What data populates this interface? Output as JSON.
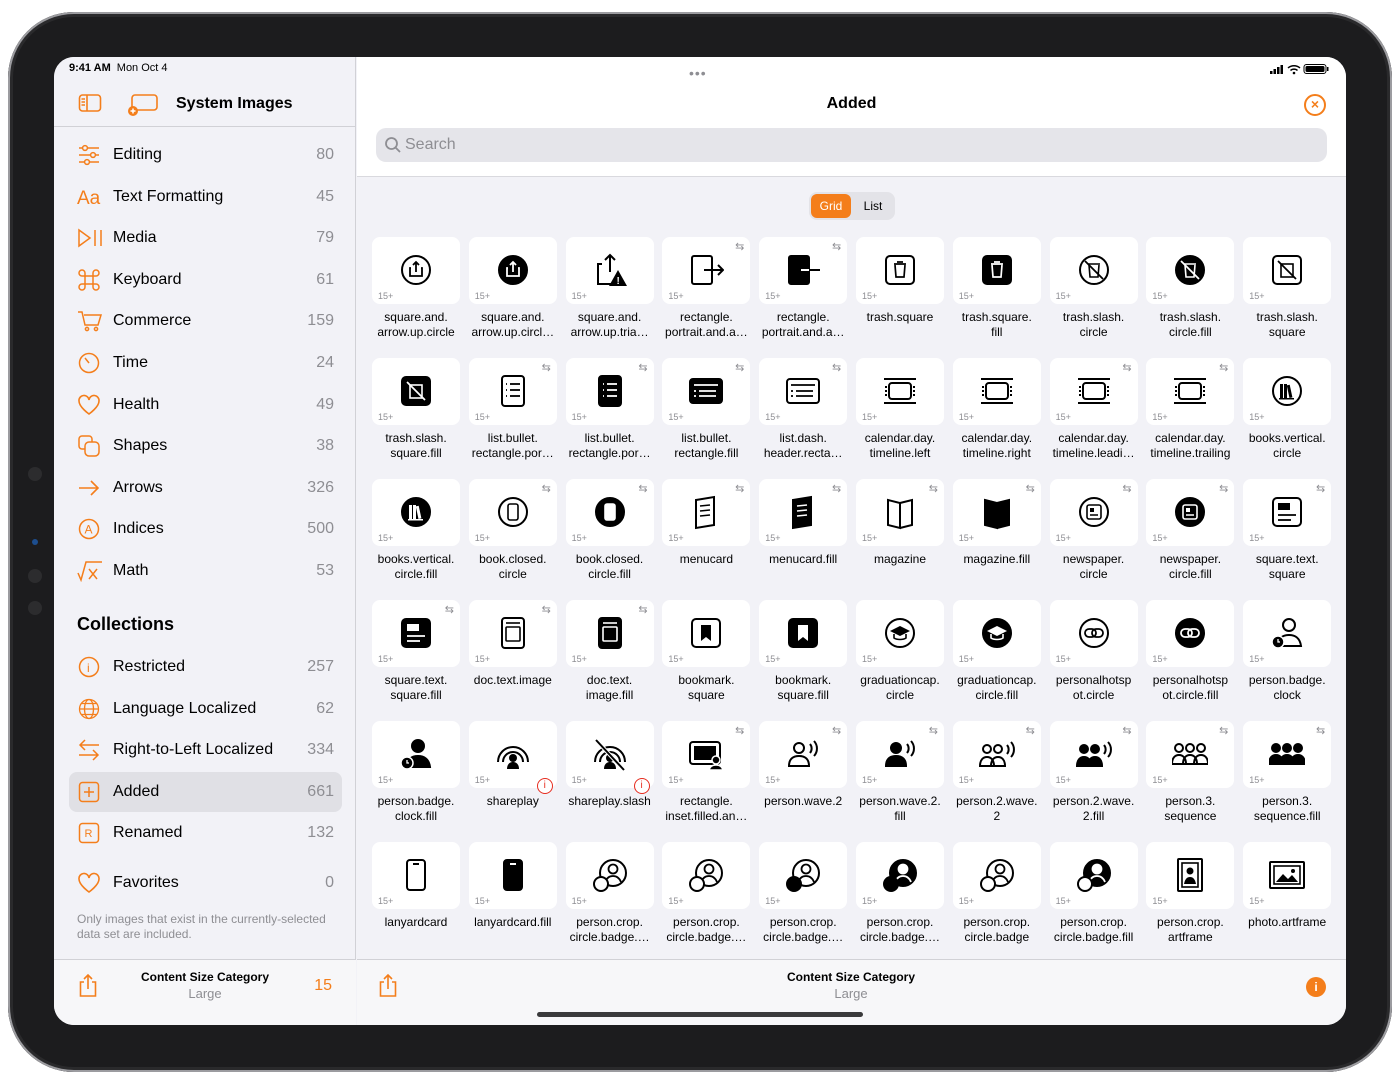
{
  "status": {
    "time": "9:41 AM",
    "date": "Mon Oct 4"
  },
  "sidebar": {
    "title": "System Images",
    "categories": [
      {
        "icon": "sliders-icon",
        "label": "Editing",
        "count": "80"
      },
      {
        "icon": "text-format-icon",
        "label": "Text Formatting",
        "count": "45"
      },
      {
        "icon": "play-pause-icon",
        "label": "Media",
        "count": "79"
      },
      {
        "icon": "command-key-icon",
        "label": "Keyboard",
        "count": "61"
      },
      {
        "icon": "cart-icon",
        "label": "Commerce",
        "count": "159"
      },
      {
        "icon": "timer-icon",
        "label": "Time",
        "count": "24"
      },
      {
        "icon": "heart-icon",
        "label": "Health",
        "count": "49"
      },
      {
        "icon": "shapes-icon",
        "label": "Shapes",
        "count": "38"
      },
      {
        "icon": "arrow-right-icon",
        "label": "Arrows",
        "count": "326"
      },
      {
        "icon": "indices-icon",
        "label": "Indices",
        "count": "500"
      },
      {
        "icon": "function-icon",
        "label": "Math",
        "count": "53"
      }
    ],
    "collections_header": "Collections",
    "collections": [
      {
        "icon": "info-circle-icon",
        "label": "Restricted",
        "count": "257"
      },
      {
        "icon": "globe-icon",
        "label": "Language Localized",
        "count": "62"
      },
      {
        "icon": "rtl-arrows-icon",
        "label": "Right-to-Left Localized",
        "count": "334"
      },
      {
        "icon": "plus-square-icon",
        "label": "Added",
        "count": "661",
        "selected": true
      },
      {
        "icon": "renamed-icon",
        "label": "Renamed",
        "count": "132"
      }
    ],
    "favorites": {
      "icon": "heart-icon",
      "label": "Favorites",
      "count": "0"
    },
    "footnote": "Only images that exist in the currently-selected data set are included.",
    "bottom": {
      "title": "Content Size Category",
      "subtitle": "Large",
      "value": "15"
    }
  },
  "main": {
    "title": "Added",
    "search_placeholder": "Search",
    "view_modes": [
      "Grid",
      "List"
    ],
    "active_view": "Grid",
    "version_tag": "15+",
    "bottom": {
      "title": "Content Size Category",
      "subtitle": "Large"
    },
    "symbols": [
      {
        "name": "square.and.\narrow.up.circle",
        "icon": "share-circle-icon"
      },
      {
        "name": "square.and.\narrow.up.circl…",
        "icon": "share-circle-fill-icon"
      },
      {
        "name": "square.and.\narrow.up.tria…",
        "icon": "share-triangle-icon"
      },
      {
        "name": "rectangle.\nportrait.and.a…",
        "icon": "portrait-arrow-icon",
        "rtl": true
      },
      {
        "name": "rectangle.\nportrait.and.a…",
        "icon": "portrait-arrow-fill-icon",
        "rtl": true
      },
      {
        "name": "trash.square",
        "icon": "trash-square-icon"
      },
      {
        "name": "trash.square.\nfill",
        "icon": "trash-square-fill-icon"
      },
      {
        "name": "trash.slash.\ncircle",
        "icon": "trash-slash-circle-icon"
      },
      {
        "name": "trash.slash.\ncircle.fill",
        "icon": "trash-slash-circle-fill-icon"
      },
      {
        "name": "trash.slash.\nsquare",
        "icon": "trash-slash-square-icon"
      },
      {
        "name": "trash.slash.\nsquare.fill",
        "icon": "trash-slash-square-fill-icon"
      },
      {
        "name": "list.bullet.\nrectangle.por…",
        "icon": "list-portrait-icon",
        "rtl": true
      },
      {
        "name": "list.bullet.\nrectangle.por…",
        "icon": "list-portrait-fill-icon",
        "rtl": true
      },
      {
        "name": "list.bullet.\nrectangle.fill",
        "icon": "list-rect-fill-icon",
        "rtl": true
      },
      {
        "name": "list.dash.\nheader.recta…",
        "icon": "list-header-icon",
        "rtl": true
      },
      {
        "name": "calendar.day.\ntimeline.left",
        "icon": "timeline-left-icon"
      },
      {
        "name": "calendar.day.\ntimeline.right",
        "icon": "timeline-right-icon"
      },
      {
        "name": "calendar.day.\ntimeline.leadi…",
        "icon": "timeline-leading-icon",
        "rtl": true
      },
      {
        "name": "calendar.day.\ntimeline.trailing",
        "icon": "timeline-trailing-icon",
        "rtl": true
      },
      {
        "name": "books.vertical.\ncircle",
        "icon": "books-circle-icon"
      },
      {
        "name": "books.vertical.\ncircle.fill",
        "icon": "books-circle-fill-icon"
      },
      {
        "name": "book.closed.\ncircle",
        "icon": "book-circle-icon",
        "rtl": true
      },
      {
        "name": "book.closed.\ncircle.fill",
        "icon": "book-circle-fill-icon",
        "rtl": true
      },
      {
        "name": "menucard",
        "icon": "menucard-icon",
        "rtl": true
      },
      {
        "name": "menucard.fill",
        "icon": "menucard-fill-icon",
        "rtl": true
      },
      {
        "name": "magazine",
        "icon": "magazine-icon",
        "rtl": true
      },
      {
        "name": "magazine.fill",
        "icon": "magazine-fill-icon",
        "rtl": true
      },
      {
        "name": "newspaper.\ncircle",
        "icon": "newspaper-circle-icon",
        "rtl": true
      },
      {
        "name": "newspaper.\ncircle.fill",
        "icon": "newspaper-circle-fill-icon",
        "rtl": true
      },
      {
        "name": "square.text.\nsquare",
        "icon": "square-text-icon",
        "rtl": true
      },
      {
        "name": "square.text.\nsquare.fill",
        "icon": "square-text-fill-icon",
        "rtl": true
      },
      {
        "name": "doc.text.image",
        "icon": "doc-image-icon",
        "rtl": true
      },
      {
        "name": "doc.text.\nimage.fill",
        "icon": "doc-image-fill-icon",
        "rtl": true
      },
      {
        "name": "bookmark.\nsquare",
        "icon": "bookmark-square-icon"
      },
      {
        "name": "bookmark.\nsquare.fill",
        "icon": "bookmark-square-fill-icon"
      },
      {
        "name": "graduationcap.\ncircle",
        "icon": "gradcap-circle-icon"
      },
      {
        "name": "graduationcap.\ncircle.fill",
        "icon": "gradcap-circle-fill-icon"
      },
      {
        "name": "personalhotsp\not.circle",
        "icon": "hotspot-circle-icon"
      },
      {
        "name": "personalhotsp\not.circle.fill",
        "icon": "hotspot-circle-fill-icon"
      },
      {
        "name": "person.badge.\nclock",
        "icon": "person-clock-icon"
      },
      {
        "name": "person.badge.\nclock.fill",
        "icon": "person-clock-fill-icon"
      },
      {
        "name": "shareplay",
        "icon": "shareplay-icon",
        "restricted": true
      },
      {
        "name": "shareplay.slash",
        "icon": "shareplay-slash-icon",
        "restricted": true
      },
      {
        "name": "rectangle.\ninset.filled.an…",
        "icon": "rect-person-icon",
        "rtl": true
      },
      {
        "name": "person.wave.2",
        "icon": "person-wave-icon",
        "rtl": true
      },
      {
        "name": "person.wave.2.\nfill",
        "icon": "person-wave-fill-icon",
        "rtl": true
      },
      {
        "name": "person.2.wave.\n2",
        "icon": "person2-wave-icon",
        "rtl": true
      },
      {
        "name": "person.2.wave.\n2.fill",
        "icon": "person2-wave-fill-icon",
        "rtl": true
      },
      {
        "name": "person.3.\nsequence",
        "icon": "person3-seq-icon",
        "rtl": true
      },
      {
        "name": "person.3.\nsequence.fill",
        "icon": "person3-seq-fill-icon",
        "rtl": true
      },
      {
        "name": "lanyardcard",
        "icon": "lanyard-icon"
      },
      {
        "name": "lanyardcard.fill",
        "icon": "lanyard-fill-icon"
      },
      {
        "name": "person.crop.\ncircle.badge.…",
        "icon": "person-crop-badge-icon"
      },
      {
        "name": "person.crop.\ncircle.badge.…",
        "icon": "person-crop-badge-icon"
      },
      {
        "name": "person.crop.\ncircle.badge.…",
        "icon": "person-crop-badge-clock-icon"
      },
      {
        "name": "person.crop.\ncircle.badge.…",
        "icon": "person-crop-badge-clock-fill-icon"
      },
      {
        "name": "person.crop.\ncircle.badge",
        "icon": "person-crop-badge-icon"
      },
      {
        "name": "person.crop.\ncircle.badge.fill",
        "icon": "person-crop-badge-fill-icon"
      },
      {
        "name": "person.crop.\nartframe",
        "icon": "artframe-person-icon"
      },
      {
        "name": "photo.artframe",
        "icon": "photo-artframe-icon"
      }
    ]
  },
  "colors": {
    "accent": "#f47e1b",
    "restricted": "#e62d20"
  }
}
